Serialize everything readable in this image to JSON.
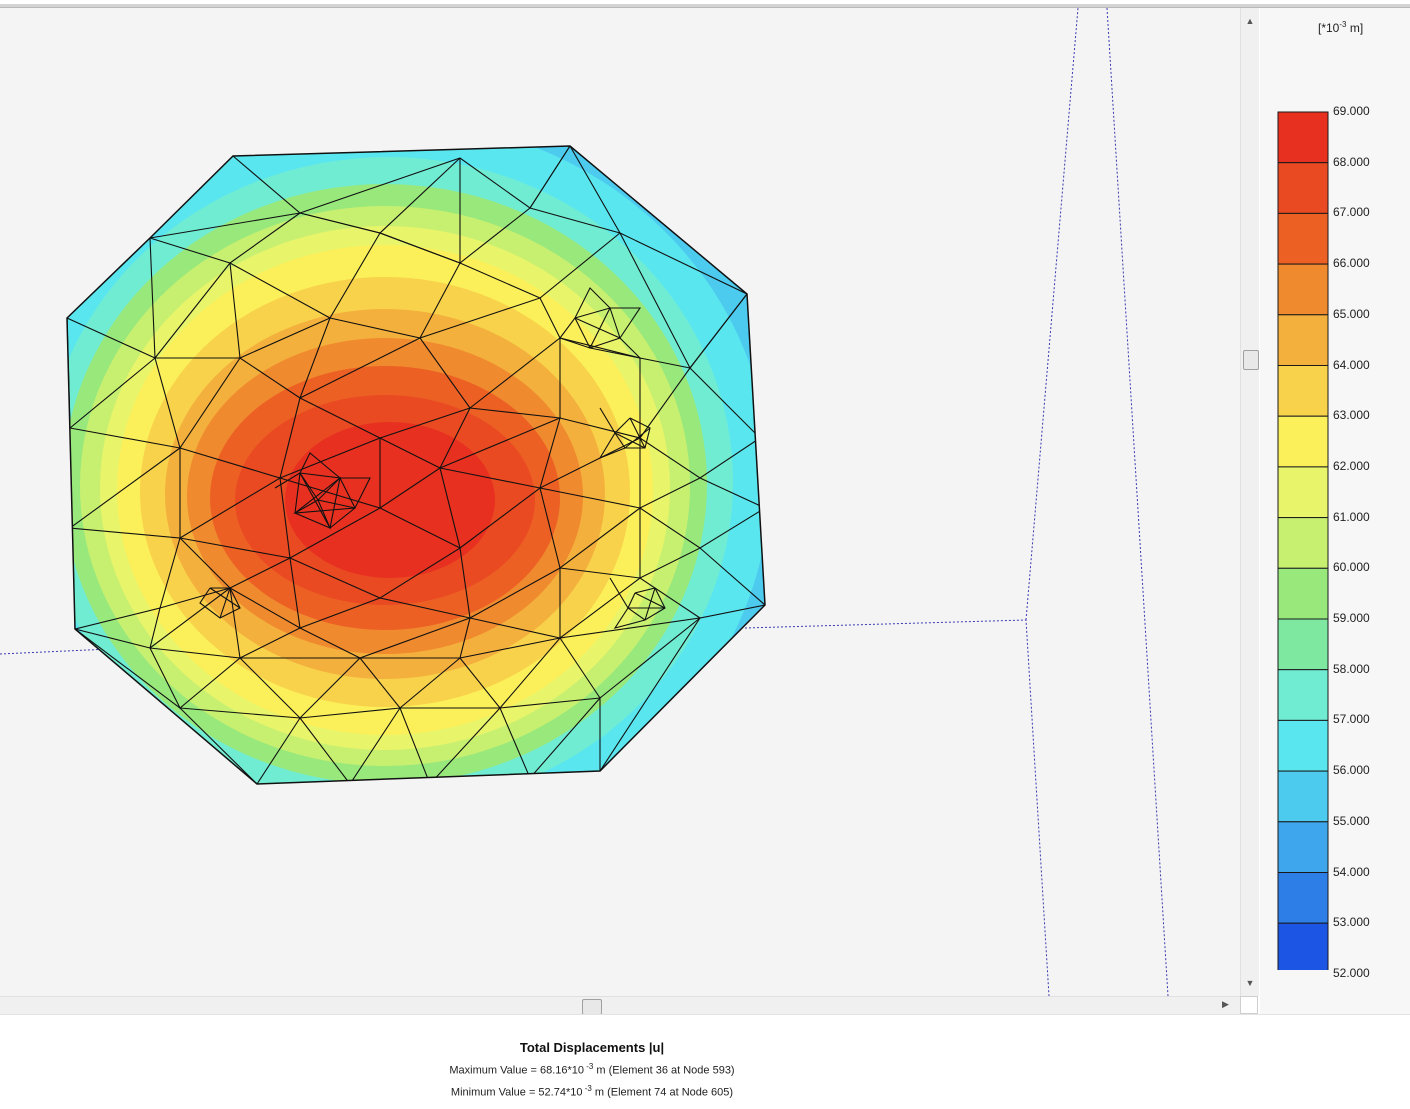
{
  "legend": {
    "unit_prefix": "[*10",
    "unit_exponent": "-3",
    "unit_suffix": " m]",
    "labels": [
      "69.000",
      "68.000",
      "67.000",
      "66.000",
      "65.000",
      "64.000",
      "63.000",
      "62.000",
      "61.000",
      "60.000",
      "59.000",
      "58.000",
      "57.000",
      "56.000",
      "55.000",
      "54.000",
      "53.000",
      "52.000"
    ],
    "colors": [
      "#e83020",
      "#ea4a22",
      "#ec6024",
      "#f08a2e",
      "#f4b03c",
      "#f8d24a",
      "#fbf05a",
      "#e8f46a",
      "#c8f070",
      "#98e87c",
      "#7ee8a0",
      "#70ecd2",
      "#5ae6ef",
      "#4ccbef",
      "#3ea6ec",
      "#2e7ee8",
      "#1c54e4"
    ]
  },
  "caption": {
    "title": "Total Displacements |u|",
    "max_prefix": "Maximum Value = 68.16*10",
    "max_exponent": " -3",
    "max_suffix": " m (Element 36 at Node 593)",
    "min_prefix": "Minimum Value = 52.74*10",
    "min_exponent": " -3",
    "min_suffix": " m (Element 74 at Node 605)"
  },
  "model": {
    "max_displacement": 68.16,
    "min_displacement": 52.74
  }
}
